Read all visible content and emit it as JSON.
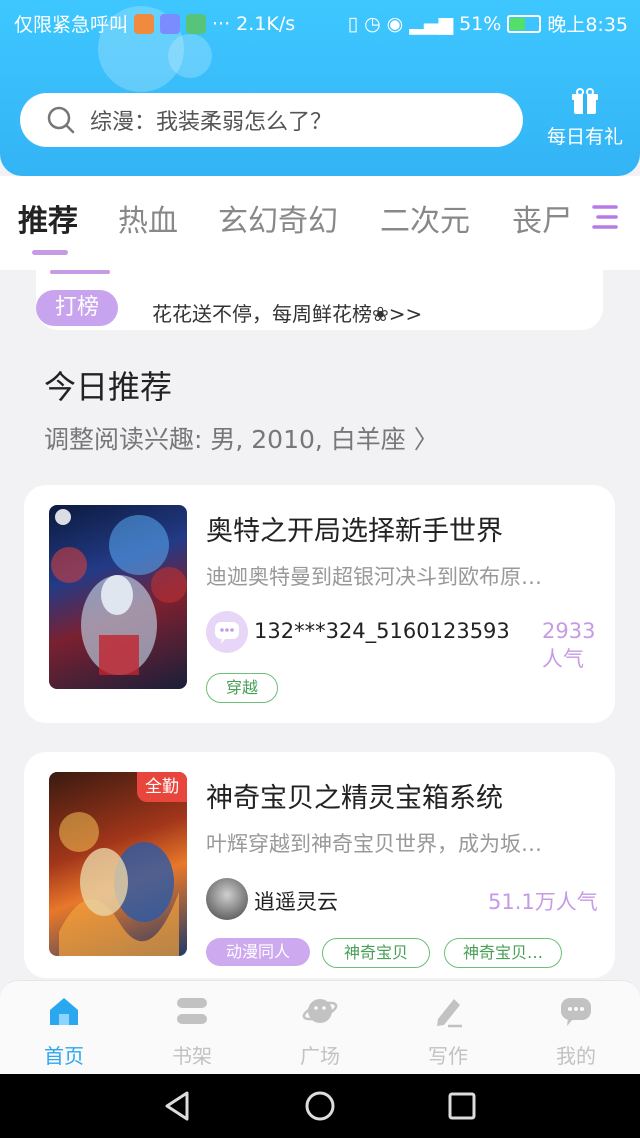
{
  "status_bar": {
    "left_text": "仅限紧急呼叫",
    "network_speed": "2.1K/s",
    "battery": "51%",
    "time": "晚上8:35"
  },
  "search": {
    "placeholder": "综漫：我装柔弱怎么了？"
  },
  "gift": {
    "label": "每日有礼"
  },
  "tabs": [
    {
      "label": "推荐"
    },
    {
      "label": "热血"
    },
    {
      "label": "玄幻奇幻"
    },
    {
      "label": "二次元"
    },
    {
      "label": "丧尸"
    }
  ],
  "notice": {
    "badge": "打榜",
    "text": "花花送不停，每周鲜花榜❀>>"
  },
  "section": {
    "title": "今日推荐",
    "subtitle": "调整阅读兴趣: 男, 2010, 白羊座 〉"
  },
  "books": [
    {
      "title": "奥特之开局选择新手世界",
      "desc": "迪迦奥特曼到超银河决斗到欧布原…",
      "author": "132***324_5160123593",
      "popularity": "2933人气",
      "tags": [
        "穿越"
      ]
    },
    {
      "title": "神奇宝贝之精灵宝箱系统",
      "desc": "叶辉穿越到神奇宝贝世界，成为坂…",
      "author": "逍遥灵云",
      "popularity": "51.1万人气",
      "cover_badge": "全勤",
      "tags": [
        "动漫同人",
        "神奇宝贝",
        "神奇宝贝…"
      ]
    }
  ],
  "bottom_nav": [
    {
      "label": "首页",
      "icon": "home-icon"
    },
    {
      "label": "书架",
      "icon": "bookshelf-icon"
    },
    {
      "label": "广场",
      "icon": "planet-icon"
    },
    {
      "label": "写作",
      "icon": "pen-icon"
    },
    {
      "label": "我的",
      "icon": "chat-face-icon"
    }
  ],
  "colors": {
    "header": "#3ec7ff",
    "accent_purple": "#c69be6",
    "nav_active": "#2ba7f0",
    "tag_green": "#6cbf77"
  }
}
